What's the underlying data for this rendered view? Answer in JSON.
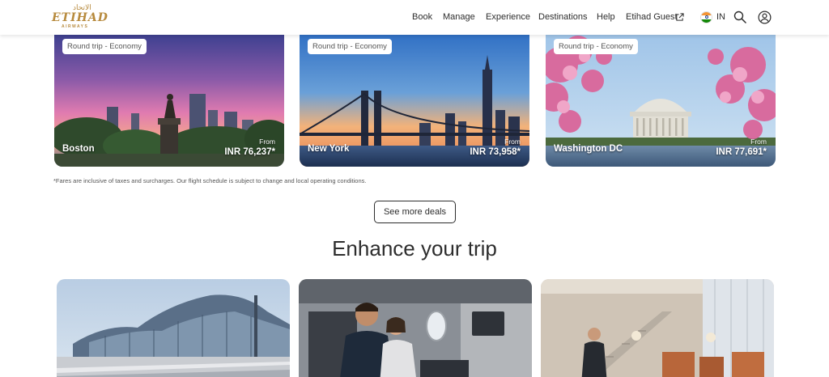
{
  "header": {
    "logo": {
      "main": "ETIHAD",
      "sub": "AIRWAYS",
      "arabic": "الاتحاد"
    },
    "nav": [
      {
        "label": "Book"
      },
      {
        "label": "Manage"
      },
      {
        "label": "Experience"
      },
      {
        "label": "Destinations"
      },
      {
        "label": "Help"
      },
      {
        "label": "Etihad Guest"
      }
    ],
    "country": {
      "code": "IN",
      "flag_icon": "india-flag-icon"
    }
  },
  "deals": [
    {
      "badge": "Round trip - Economy",
      "city": "Boston",
      "from_label": "From",
      "price": "INR 76,237*"
    },
    {
      "badge": "Round trip - Economy",
      "city": "New York",
      "from_label": "From",
      "price": "INR 73,958*"
    },
    {
      "badge": "Round trip - Economy",
      "city": "Washington DC",
      "from_label": "From",
      "price": "INR 77,691*"
    }
  ],
  "disclaimer": "*Fares are inclusive of taxes and surcharges. Our flight schedule is subject to change and local operating conditions.",
  "see_more_label": "See more deals",
  "enhance": {
    "title": "Enhance your trip",
    "cards": [
      {
        "image": "airport-terminal-image"
      },
      {
        "image": "cabin-passengers-image"
      },
      {
        "image": "lounge-image"
      }
    ]
  },
  "colors": {
    "brand_gold": "#b78a3d",
    "text_dark": "#2d2d2d"
  }
}
